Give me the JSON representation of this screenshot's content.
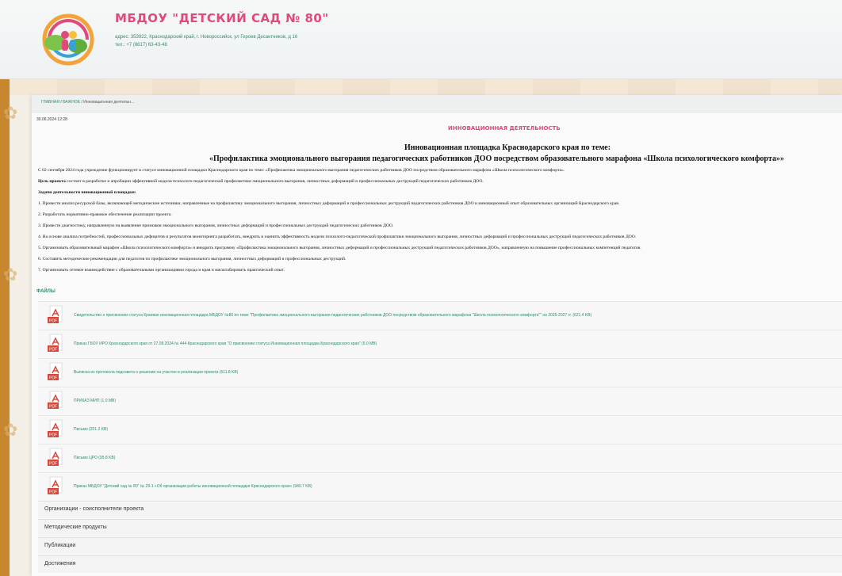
{
  "header": {
    "org_name": "МБДОУ \"ДЕТСКИЙ САД № 80\"",
    "address": "адрес: 353922, Краснодарский край, г. Новороссийск, ул Героев Десантников, д 16",
    "phone": "тел.: +7 (8617) 63-43-48"
  },
  "breadcrumb": {
    "home": "ГЛАВНАЯ",
    "sep": "/",
    "important": "ВАЖНОЕ",
    "current": "Инновационная деятельн..."
  },
  "article": {
    "date": "30.06.2024 12:28",
    "section_title": "ИННОВАЦИОННАЯ ДЕЯТЕЛЬНОСТЬ",
    "heading1": "Инновационная площадка Краснодарского края по теме:",
    "heading2": "«Профилактика эмоционального выгорания педагогических работников ДОО посредством образовательного марафона «Школа психологического комфорта»»",
    "p1": "С 02 сентября 2024 года учреждение функционирует в статусе инновационной площадки Краснодарского края по теме: «Профилактика эмоционального выгорания педагогических работников ДОО посредством образовательного марафона «Школа психологического комфорта».",
    "goal_label": "Цель проекта",
    "goal_text": " состоит в разработке и апробации эффективной модели психолого-педагогической профилактики эмоционального выгорания, личностных деформаций и профессиональных деструкций педагогических работников ДОО.",
    "tasks_label": "Задачи деятельности инновационной площадки:",
    "tasks": [
      "1. Провести анализ ресурсной базы, включающей методические источники, направленные на профилактику эмоционального выгорания, личностных деформаций и профессиональных деструкций педагогических работников ДОО и инновационный опыт образовательных организаций Краснодарского края.",
      "2. Разработать нормативно-правовое обеспечение реализации проекта.",
      "3. Провести диагностику, направленную на выявление признаков эмоционального выгорания, личностных деформаций и профессиональных деструкций педагогических работников ДОО.",
      "4. На основе анализа потребностей, профессиональных дефицитов и результатов мониторинга разработать, внедрить и оценить эффективность модели психолого-педагогической профилактики эмоционального выгорания, личностных деформаций и профессиональных деструкций педагогических работников ДОО.",
      "5. Организовать образовательный марафон «Школа психологического комфорта» и внедрить программу «Профилактика эмоционального выгорания, личностных деформаций и профессиональных деструкций педагогических работников ДОО», направленную на повышение профессиональных компетенций педагогов.",
      "6. Составить методические рекомендации для педагогов по профилактике эмоционального выгорания, личностных деформаций и профессиональных деструкций.",
      "7. Организовать сетевое взаимодействие с образовательными организациями города и края и масштабировать практический опыт."
    ]
  },
  "files": {
    "heading": "ФАЙЛЫ",
    "icon": "pdf-file-icon",
    "icon_label": "PDF",
    "items": [
      "Свидетельство о присвоении статуса Краевая инновационная площадка МБДОУ №80 по теме \"Профилактика эмоционального выгорания педагогических работников ДОО посредством образовательного марафона \"Школа психологического комфорта\"\" на 2025-2027 гг. (621.4 KB)",
      "Приказ ГБОУ ИРО Краснодарского края от 27.08.2024 № 444 Краснодарского края \"О присвоении статуса Инновационная площадка Краснодарского края\" (6.0 MB)",
      "Выписка из протокола педсовета о решении на участие в реализации проекта (511.8 KB)",
      "ПРИКАЗ МИП (1.0 MB)",
      "Письмо (201.2 KB)",
      "Письмо ЦРО (95.8 KB)",
      "Приказ МБДОУ \"Детский сад № 80\" № 29-1 «Об организации работы инновационной площадки Краснодарского края» (940.7 KB)"
    ]
  },
  "accordion": [
    "Организации - соисполнители проекта",
    "Методические продукты",
    "Публикации",
    "Достижения"
  ],
  "colors": {
    "brand_pink": "#e0497b",
    "link_green": "#2e8c6a",
    "pdf_red": "#d9473a",
    "accent_orange": "#c8872f"
  }
}
